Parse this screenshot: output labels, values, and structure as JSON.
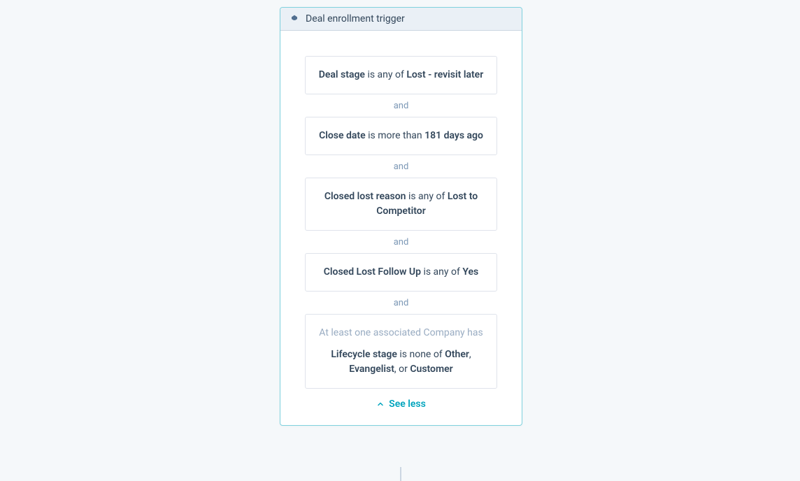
{
  "header": {
    "title": "Deal enrollment trigger"
  },
  "connector": "and",
  "criteria": {
    "c1": {
      "field": "Deal stage",
      "operator": " is any of ",
      "value": "Lost - revisit later"
    },
    "c2": {
      "field": "Close date",
      "operator": " is more than ",
      "value": "181 days ago"
    },
    "c3": {
      "field": "Closed lost reason",
      "operator": " is any of ",
      "value": "Lost to Competitor"
    },
    "c4": {
      "field": "Closed Lost Follow Up",
      "operator": " is any of ",
      "value": "Yes"
    },
    "c5": {
      "assoc": "At least one associated Company has",
      "field": "Lifecycle stage",
      "operator": " is none of ",
      "v1": "Other",
      "sep1": ", ",
      "v2": "Evangelist",
      "sep2": ", or ",
      "v3": "Customer"
    }
  },
  "see_less": "See less"
}
